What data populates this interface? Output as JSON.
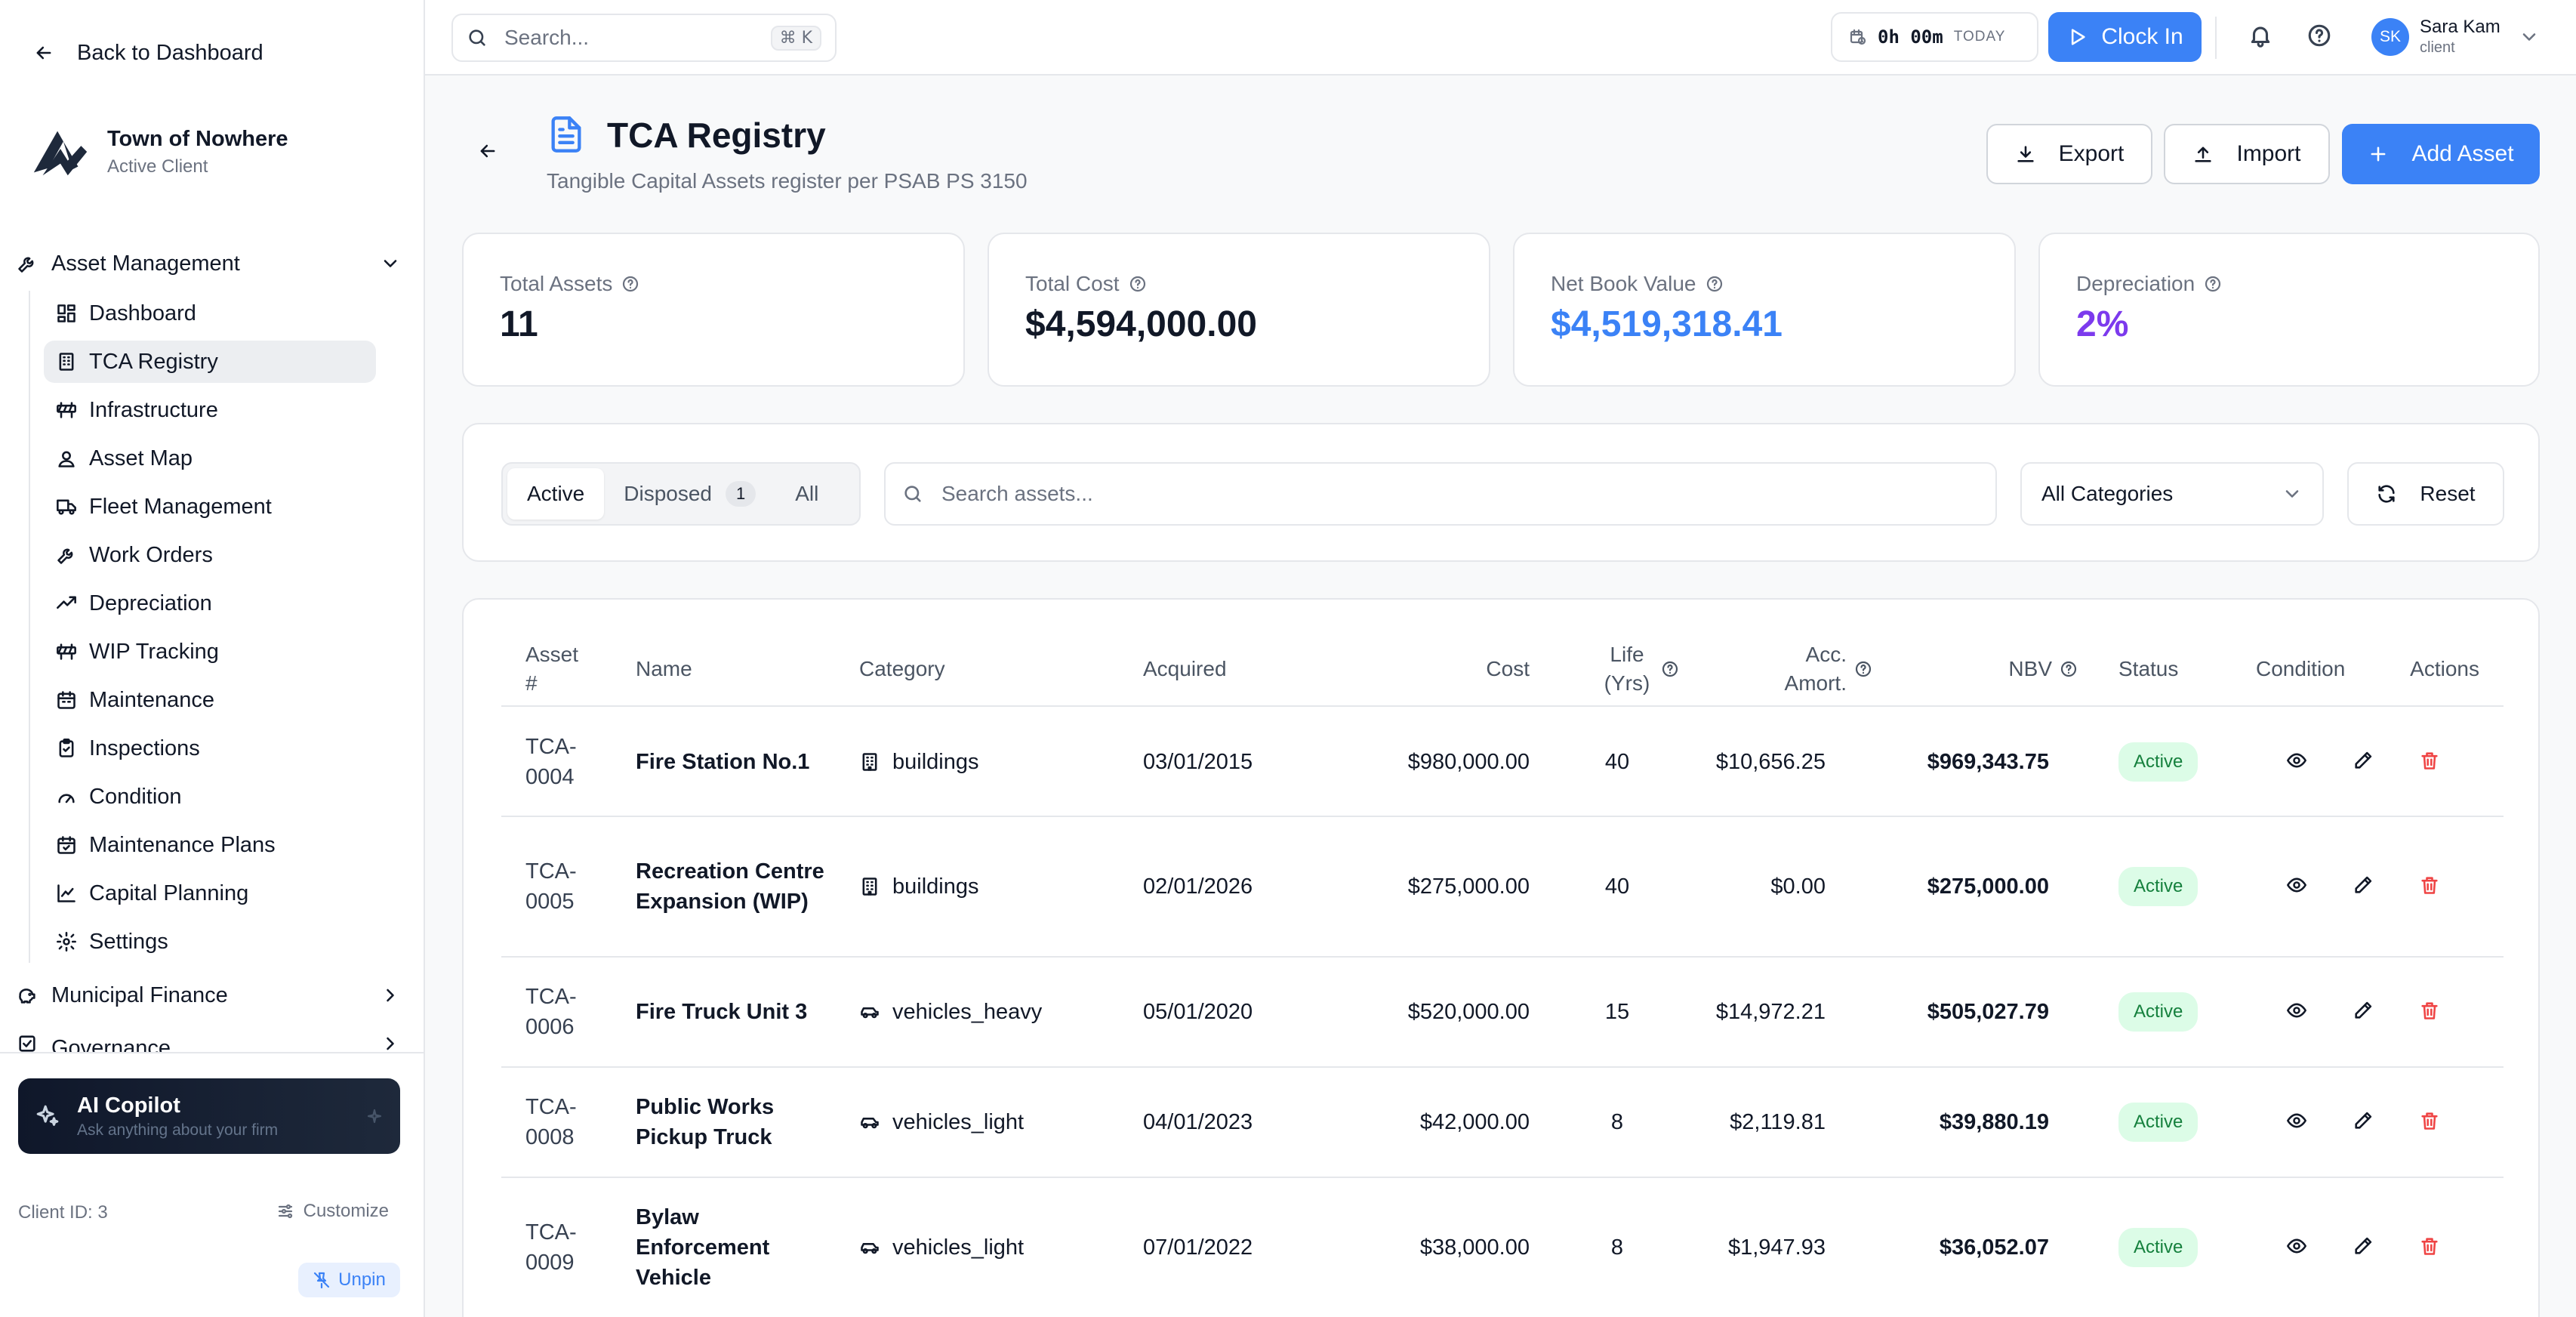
{
  "sidebar": {
    "back_label": "Back to Dashboard",
    "org_name": "Town of Nowhere",
    "org_status": "Active Client",
    "group_asset_management": "Asset Management",
    "items": [
      {
        "label": "Dashboard",
        "icon": "dashboard-icon"
      },
      {
        "label": "TCA Registry",
        "icon": "building-icon",
        "active": true
      },
      {
        "label": "Infrastructure",
        "icon": "barrier-icon"
      },
      {
        "label": "Asset Map",
        "icon": "map-pin-icon"
      },
      {
        "label": "Fleet Management",
        "icon": "truck-icon"
      },
      {
        "label": "Work Orders",
        "icon": "wrench-icon"
      },
      {
        "label": "Depreciation",
        "icon": "trend-icon"
      },
      {
        "label": "WIP Tracking",
        "icon": "barrier-icon"
      },
      {
        "label": "Maintenance",
        "icon": "calendar-icon"
      },
      {
        "label": "Inspections",
        "icon": "clipboard-icon"
      },
      {
        "label": "Condition",
        "icon": "gauge-icon"
      },
      {
        "label": "Maintenance Plans",
        "icon": "calendar-check-icon"
      },
      {
        "label": "Capital Planning",
        "icon": "chart-icon"
      },
      {
        "label": "Settings",
        "icon": "gear-icon"
      }
    ],
    "group_municipal_finance": "Municipal Finance",
    "group_governance": "Governance",
    "copilot_title": "AI Copilot",
    "copilot_sub": "Ask anything about your firm",
    "client_id": "Client ID: 3",
    "customize_label": "Customize",
    "unpin_label": "Unpin"
  },
  "topbar": {
    "search_placeholder": "Search...",
    "search_shortcut": "⌘ K",
    "timer_value": "0h 00m",
    "timer_label": "TODAY",
    "clock_in_label": "Clock In",
    "user_initials": "SK",
    "user_name": "Sara Kam",
    "user_role": "client"
  },
  "page": {
    "title": "TCA Registry",
    "subtitle": "Tangible Capital Assets register per PSAB PS 3150",
    "export_label": "Export",
    "import_label": "Import",
    "add_label": "Add Asset"
  },
  "stats": {
    "total_assets_label": "Total Assets",
    "total_assets_value": "11",
    "total_cost_label": "Total Cost",
    "total_cost_value": "$4,594,000.00",
    "nbv_label": "Net Book Value",
    "nbv_value": "$4,519,318.41",
    "depreciation_label": "Depreciation",
    "depreciation_value": "2%",
    "colors": {
      "nbv": "#3b82f6",
      "depreciation": "#7c3aed"
    }
  },
  "filters": {
    "tab_active": "Active",
    "tab_disposed": "Disposed",
    "tab_disposed_count": "1",
    "tab_all": "All",
    "search_placeholder": "Search assets...",
    "category_value": "All Categories",
    "reset_label": "Reset"
  },
  "table": {
    "headers": {
      "asset": "Asset #",
      "name": "Name",
      "category": "Category",
      "acquired": "Acquired",
      "cost": "Cost",
      "life": "Life (Yrs)",
      "amort": "Acc. Amort.",
      "nbv": "NBV",
      "status": "Status",
      "condition": "Condition",
      "actions": "Actions"
    },
    "rows": [
      {
        "asset": "TCA-0004",
        "name": "Fire Station No.1",
        "category": "buildings",
        "cat_icon": "building-icon",
        "acquired": "03/01/2015",
        "cost": "$980,000.00",
        "life": "40",
        "amort": "$10,656.25",
        "nbv": "$969,343.75",
        "status": "Active",
        "condition": ""
      },
      {
        "asset": "TCA-0005",
        "name": "Recreation Centre Expansion (WIP)",
        "category": "buildings",
        "cat_icon": "building-icon",
        "acquired": "02/01/2026",
        "cost": "$275,000.00",
        "life": "40",
        "amort": "$0.00",
        "nbv": "$275,000.00",
        "status": "Active",
        "condition": ""
      },
      {
        "asset": "TCA-0006",
        "name": "Fire Truck Unit 3",
        "category": "vehicles_heavy",
        "cat_icon": "car-icon",
        "acquired": "05/01/2020",
        "cost": "$520,000.00",
        "life": "15",
        "amort": "$14,972.21",
        "nbv": "$505,027.79",
        "status": "Active",
        "condition": ""
      },
      {
        "asset": "TCA-0008",
        "name": "Public Works Pickup Truck",
        "category": "vehicles_light",
        "cat_icon": "car-icon",
        "acquired": "04/01/2023",
        "cost": "$42,000.00",
        "life": "8",
        "amort": "$2,119.81",
        "nbv": "$39,880.19",
        "status": "Active",
        "condition": ""
      },
      {
        "asset": "TCA-0009",
        "name": "Bylaw Enforcement Vehicle",
        "category": "vehicles_light",
        "cat_icon": "car-icon",
        "acquired": "07/01/2022",
        "cost": "$38,000.00",
        "life": "8",
        "amort": "$1,947.93",
        "nbv": "$36,052.07",
        "status": "Active",
        "condition": ""
      }
    ]
  }
}
